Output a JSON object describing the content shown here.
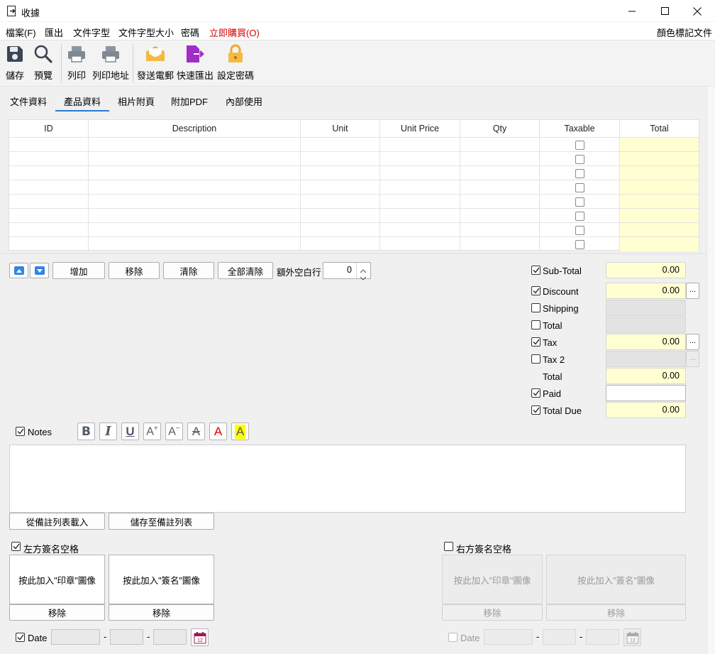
{
  "window": {
    "title": "收據"
  },
  "menu": {
    "items": [
      "檔案(F)",
      "匯出",
      "文件字型",
      "文件字型大小",
      "密碼",
      "立即購買(O)"
    ],
    "right": "顏色標記文件",
    "buy_color": "#d40000"
  },
  "toolbar": {
    "buttons": [
      "儲存",
      "預覽",
      "列印",
      "列印地址",
      "發送電郵",
      "快速匯出",
      "設定密碼"
    ]
  },
  "tabs": {
    "items": [
      "文件資料",
      "產品資料",
      "相片附頁",
      "附加PDF",
      "內部使用"
    ],
    "active": "產品資料",
    "accent": "#2b79d0"
  },
  "grid": {
    "columns": [
      "ID",
      "Description",
      "Unit",
      "Unit Price",
      "Qty",
      "Taxable",
      "Total"
    ],
    "total_col_color": "#ffffd2"
  },
  "row_actions": {
    "add": "增加",
    "remove": "移除",
    "clear": "清除",
    "clear_all": "全部清除",
    "extra_blank_label": "額外空白行",
    "extra_blank_value": "0"
  },
  "summary": {
    "subtotal": {
      "label": "Sub-Total",
      "value": "0.00"
    },
    "discount": {
      "label": "Discount",
      "value": "0.00"
    },
    "shipping": {
      "label": "Shipping"
    },
    "total1": {
      "label": "Total"
    },
    "tax": {
      "label": "Tax",
      "value": "0.00"
    },
    "tax2": {
      "label": "Tax 2"
    },
    "total2": {
      "label": "Total",
      "value": "0.00"
    },
    "paid": {
      "label": "Paid"
    },
    "total_due": {
      "label": "Total Due",
      "value": "0.00"
    },
    "dots": "..."
  },
  "notes": {
    "label": "Notes",
    "load_btn": "從備註列表載入",
    "save_btn": "儲存至備註列表"
  },
  "signature": {
    "left_label": "左方簽名空格",
    "right_label": "右方簽名空格",
    "stamp_btn": "按此加入\"印章\"圖像",
    "sign_btn": "按此加入\"簽名\"圖像",
    "remove": "移除",
    "date_label": "Date",
    "dash": "-",
    "cal_day": "12"
  }
}
